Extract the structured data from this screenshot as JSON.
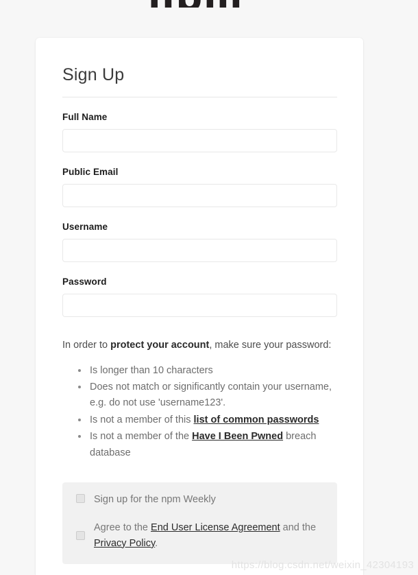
{
  "brand": {
    "wordmark": "npm",
    "wordmark_color": "#231f20"
  },
  "card": {
    "title": "Sign Up"
  },
  "form": {
    "fields": [
      {
        "label": "Full Name",
        "value": "",
        "placeholder": "",
        "type": "text"
      },
      {
        "label": "Public Email",
        "value": "",
        "placeholder": "",
        "type": "email"
      },
      {
        "label": "Username",
        "value": "",
        "placeholder": "",
        "type": "text"
      },
      {
        "label": "Password",
        "value": "",
        "placeholder": "",
        "type": "password"
      }
    ]
  },
  "password_help": {
    "intro_before": "In order to ",
    "intro_strong": "protect your account",
    "intro_after": ", make sure your password:",
    "rules": [
      {
        "before": "Is longer than 10 characters",
        "link": "",
        "after": ""
      },
      {
        "before": "Does not match or significantly contain your username, e.g. do not use 'username123'.",
        "link": "",
        "after": ""
      },
      {
        "before": "Is not a member of this ",
        "link": "list of common passwords",
        "after": ""
      },
      {
        "before": "Is not a member of the ",
        "link": "Have I Been Pwned",
        "after": " breach database"
      }
    ]
  },
  "consent": {
    "newsletter": {
      "label": "Sign up for the npm Weekly",
      "checked": false
    },
    "terms": {
      "before": "Agree to the ",
      "eula_link": "End User License Agreement",
      "middle": " and the ",
      "privacy_link": "Privacy Policy",
      "after": ".",
      "checked": false
    }
  },
  "watermark": {
    "text": "https://blog.csdn.net/weixin_42304193"
  }
}
